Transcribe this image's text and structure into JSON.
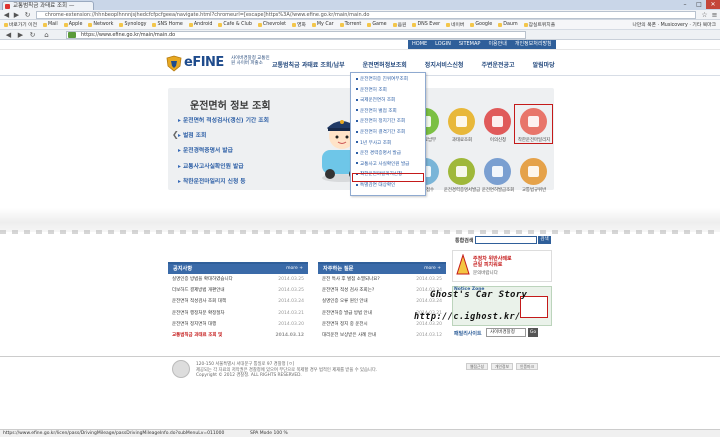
{
  "browser": {
    "tab_title": "교통범칙금 과태료 조회 —",
    "ext_url": "chrome-extension://hhnbeoplhnnnjsjhedcfcfpcfgeea/navigate.html?chromeurl=[escape]https%3A//www.efine.go.kr/main/main.do",
    "page_url": "https://www.efine.go.kr/main/main.do",
    "bookmarks": [
      "바로가기 이전",
      "Mail",
      "Apple",
      "Network",
      "Synology",
      "SNS Home",
      "Android",
      "Cafe & Club",
      "Chevrolet",
      "영화",
      "My Car",
      "Torrent",
      "Game",
      "음원",
      "DNS Ever",
      "네이버",
      "Google",
      "Daum",
      "잠실트위치플"
    ],
    "bookmarks_right": [
      "나만의 북폰",
      "Musicovery",
      "기타 북마크"
    ],
    "status_url": "https://www.efine.go.kr/licen/pass/DrivingMileage/passDrivingMileageInfo.do?subMenuLv=011000",
    "zoom": "SPA Mode  100 %"
  },
  "util_links": [
    "HOME",
    "LOGIN",
    "SITEMAP",
    "이용안내",
    "개인정보처리방침"
  ],
  "logo": {
    "text": "eFINE",
    "sub": "사이버경찰청 교통민원 사이버 파출소"
  },
  "gnb": [
    "교통범칙금 과태료 조회/납부",
    "운전면허정보조회",
    "정지서비스신청",
    "주변운전공고",
    "알림마당"
  ],
  "hero": {
    "title": "운전면허 정보 조회",
    "items": [
      "운전면허 적성검사(갱신) 기간 조회",
      "벌점 조회",
      "운전경력증명서 발급",
      "교통사고사실확인원 발급",
      "착한운전마일리지 신청 등"
    ]
  },
  "icons": [
    {
      "label": "과태료납부",
      "color": "#7bc043"
    },
    {
      "label": "과태료조회",
      "color": "#e8b83a"
    },
    {
      "label": "이의신청",
      "color": "#e05a5a"
    },
    {
      "label": "착한운전마일리지",
      "color": "#e8756a"
    },
    {
      "label": "출석접수",
      "color": "#7ab5d8"
    },
    {
      "label": "운전경력증명서발급",
      "color": "#9fb83a"
    },
    {
      "label": "운전면허발급조회",
      "color": "#7a9fd1"
    },
    {
      "label": "교통법규위반",
      "color": "#e5a24a"
    }
  ],
  "dropdown": [
    "운전면허증 진위여부조회",
    "운전면허 조회",
    "국제운전면허 조회",
    "운전면허 벌점 조회",
    "운전면허 정지기간 조회",
    "운전면허 결격기간 조회",
    "1년 무사고 조회",
    "운전 경력증명서 발급",
    "교통사고 사실확인원 발급",
    "착한운전마일리지신청",
    "특별감면 대상확인"
  ],
  "search": {
    "label": "통합검색",
    "button": "검색"
  },
  "notice": {
    "title": "공지사항",
    "more": "more +",
    "rows": [
      {
        "t": "실명인증 방법을 확대하였습니다",
        "d": "2014.03.25",
        "red": false
      },
      {
        "t": "더보하드 결제방법 개편안내",
        "d": "2014.03.25",
        "red": false
      },
      {
        "t": "운전면허 적성검사 조회 대책",
        "d": "2014.03.24",
        "red": false
      },
      {
        "t": "운전면허 행정처분 확정절차",
        "d": "2014.03.21",
        "red": false
      },
      {
        "t": "운전면허 정지면허 대행",
        "d": "2014.03.20",
        "red": false
      },
      {
        "t": "교통범칙금 과태료 조회 및",
        "d": "2014.03.12",
        "red": true
      }
    ]
  },
  "faq": {
    "title": "자주하는 질문",
    "more": "more +",
    "rows": [
      {
        "t": "운전 특사 후 벌점 소멸되나요?",
        "d": "2014.03.25"
      },
      {
        "t": "운전면허 적성 검사 조회는?",
        "d": "2014.03.24"
      },
      {
        "t": "실명인증 오류 원인 안내",
        "d": "2014.03.24"
      },
      {
        "t": "운전면허증 발급 방법 안내",
        "d": "2014.03.21"
      },
      {
        "t": "운전면허 정지 중 운전시",
        "d": "2014.03.20"
      },
      {
        "t": "대리운전 보상받은 사례 안내",
        "d": "2014.03.12"
      }
    ]
  },
  "banner": {
    "line1": "주정차 위반사례로",
    "line2": "큰일 피치워로",
    "line3": "문의바랍니다"
  },
  "promo": {
    "title": "Notice Zone"
  },
  "watermark": {
    "line1": "Ghost's Car Story",
    "line2": "http://c.ighost.kr/"
  },
  "family": {
    "label": "패밀리사이트",
    "select": "사이버경찰청",
    "go": "Go"
  },
  "footer": {
    "line1": "120-150 서울특별시 서대문구 통일로 97 경찰청  [ㅇ]",
    "line2": "제공되는 각 자료의 저작권은 경찰청에 있으며 무단으로 복제할 경우 법적인 제재를 받을 수 있습니다.",
    "line3": "Copyright © 2012 경찰청. ALL RIGHTS RESERVED."
  },
  "footer_badges": [
    "웹접근성",
    "개인정보",
    "인증마크"
  ]
}
